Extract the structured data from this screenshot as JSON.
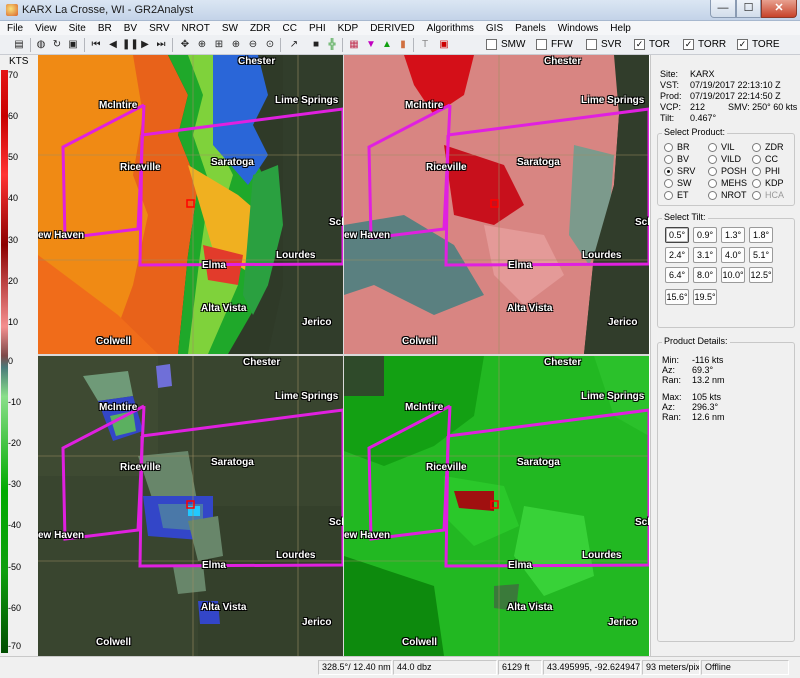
{
  "window": {
    "title": "KARX La Crosse, WI - GR2Analyst",
    "min_label": "—",
    "max_label": "☐",
    "close_label": "✕"
  },
  "menu": [
    "File",
    "View",
    "Site",
    "BR",
    "BV",
    "SRV",
    "NROT",
    "SW",
    "ZDR",
    "CC",
    "PHI",
    "KDP",
    "DERIVED",
    "Algorithms",
    "GIS",
    "Panels",
    "Windows",
    "Help"
  ],
  "warnings": [
    {
      "label": "SMW",
      "checked": false
    },
    {
      "label": "FFW",
      "checked": false
    },
    {
      "label": "SVR",
      "checked": false
    },
    {
      "label": "TOR",
      "checked": true
    },
    {
      "label": "TORR",
      "checked": true
    },
    {
      "label": "TORE",
      "checked": true
    }
  ],
  "scale": {
    "units": "KTS",
    "ticks": [
      "70",
      "60",
      "50",
      "40",
      "30",
      "20",
      "10",
      "0",
      "-10",
      "-20",
      "-30",
      "-40",
      "-50",
      "-60",
      "-70"
    ]
  },
  "towns": {
    "chester": "Chester",
    "mcintire": "McIntire",
    "lime_springs": "Lime Springs",
    "riceville": "Riceville",
    "saratoga": "Saratoga",
    "schl": "Scl",
    "new_haven": "ew Haven",
    "lourdes": "Lourdes",
    "elma": "Elma",
    "alta_vista": "Alta Vista",
    "jerico": "Jerico",
    "colwell": "Colwell"
  },
  "info": {
    "site_label": "Site:",
    "site": "KARX",
    "vst_label": "VST:",
    "vst": "07/19/2017  22:13:10 Z",
    "prod_label": "Prod:",
    "prod": "07/19/2017  22:14:50 Z",
    "vcp_label": "VCP:",
    "vcp": "212",
    "smv": "SMV:  250° 60 kts",
    "tilt_label": "Tilt:",
    "tilt": "0.467°"
  },
  "select_product": {
    "title": "Select Product:",
    "options": [
      {
        "label": "BR",
        "selected": false,
        "enabled": true
      },
      {
        "label": "VIL",
        "selected": false,
        "enabled": true
      },
      {
        "label": "ZDR",
        "selected": false,
        "enabled": true
      },
      {
        "label": "BV",
        "selected": false,
        "enabled": true
      },
      {
        "label": "VILD",
        "selected": false,
        "enabled": true
      },
      {
        "label": "CC",
        "selected": false,
        "enabled": true
      },
      {
        "label": "SRV",
        "selected": true,
        "enabled": true
      },
      {
        "label": "POSH",
        "selected": false,
        "enabled": true
      },
      {
        "label": "PHI",
        "selected": false,
        "enabled": true
      },
      {
        "label": "SW",
        "selected": false,
        "enabled": true
      },
      {
        "label": "MEHS",
        "selected": false,
        "enabled": true
      },
      {
        "label": "KDP",
        "selected": false,
        "enabled": true
      },
      {
        "label": "ET",
        "selected": false,
        "enabled": true
      },
      {
        "label": "NROT",
        "selected": false,
        "enabled": true
      },
      {
        "label": "HCA",
        "selected": false,
        "enabled": false
      }
    ]
  },
  "select_tilt": {
    "title": "Select Tilt:",
    "tilts": [
      "0.5°",
      "0.9°",
      "1.3°",
      "1.8°",
      "2.4°",
      "3.1°",
      "4.0°",
      "5.1°",
      "6.4°",
      "8.0°",
      "10.0°",
      "12.5°",
      "15.6°",
      "19.5°"
    ],
    "active": "0.5°"
  },
  "product_details": {
    "title": "Product Details:",
    "min_label": "Min:",
    "min": "-116 kts",
    "az1_label": "Az:",
    "az1": "69.3°",
    "ran1_label": "Ran:",
    "ran1": "13.2 nm",
    "max_label": "Max:",
    "max": "105 kts",
    "az2_label": "Az:",
    "az2": "296.3°",
    "ran2_label": "Ran:",
    "ran2": "12.6 nm"
  },
  "status": {
    "position": "328.5°/ 12.40 nm",
    "value": "44.0 dbz",
    "height": "6129 ft",
    "coords": "43.495995, -92.624947",
    "resolution": "93 meters/pixel",
    "mode": "Offline"
  },
  "colors": {
    "warning_polygon": "#e020e0",
    "background_map": "#39452f"
  }
}
